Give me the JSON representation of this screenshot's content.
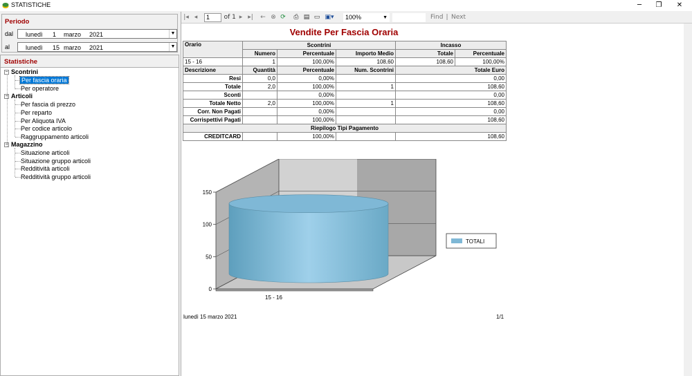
{
  "window": {
    "title": "STATISTICHE",
    "controls": {
      "minimize": "─",
      "maximize": "❐",
      "close": "✕"
    }
  },
  "periodo": {
    "title": "Periodo",
    "from": {
      "label": "dal",
      "weekday": "lunedì",
      "day": "1",
      "month": "marzo",
      "year": "2021"
    },
    "to": {
      "label": "al",
      "weekday": "lunedì",
      "day": "15",
      "month": "marzo",
      "year": "2021"
    }
  },
  "statistiche": {
    "title": "Statistiche",
    "groups": [
      {
        "label": "Scontrini",
        "items": [
          "Per fascia oraria",
          "Per operatore"
        ]
      },
      {
        "label": "Articoli",
        "items": [
          "Per fascia di prezzo",
          "Per reparto",
          "Per Aliquota IVA",
          "Per codice articolo",
          "Raggruppamento articoli"
        ]
      },
      {
        "label": "Magazzino",
        "items": [
          "Situazione articoli",
          "Situazione gruppo articoli",
          "Redditività articoli",
          "Redditività gruppo articoli"
        ]
      }
    ],
    "selected": "Per fascia oraria"
  },
  "toolbar": {
    "page": "1",
    "of_label": "of",
    "total_pages": "1",
    "zoom": "100%",
    "find": "Find",
    "separator": "|",
    "next": "Next"
  },
  "report": {
    "title": "Vendite Per Fascia Oraria",
    "header1": {
      "orario": "Orario",
      "scontrini": "Scontrini",
      "incasso": "Incasso"
    },
    "header2": {
      "numero": "Numero",
      "percentuale": "Percentuale",
      "importo_medio": "Importo Medio",
      "totale": "Totale",
      "percentuale2": "Percentuale"
    },
    "row": {
      "orario": "15 - 16",
      "numero": "1",
      "percentuale": "100,00%",
      "importo_medio": "108,60",
      "totale": "108,60",
      "percentuale2": "100,00%"
    },
    "detail_header": {
      "descrizione": "Descrizione",
      "quantita": "Quantità",
      "percentuale": "Percentuale",
      "num_scontrini": "Num. Scontrini",
      "totale_euro": "Totale Euro"
    },
    "details": [
      {
        "desc": "Resi",
        "qta": "0,0",
        "perc": "0,00%",
        "num": "",
        "tot": "0,00"
      },
      {
        "desc": "Totale",
        "qta": "2,0",
        "perc": "100,00%",
        "num": "1",
        "tot": "108,60"
      },
      {
        "desc": "Sconti",
        "qta": "",
        "perc": "0,00%",
        "num": "",
        "tot": "0,00"
      },
      {
        "desc": "Totale Netto",
        "qta": "2,0",
        "perc": "100,00%",
        "num": "1",
        "tot": "108,60"
      },
      {
        "desc": "Corr. Non Pagati",
        "qta": "",
        "perc": "0,00%",
        "num": "",
        "tot": "0,00"
      },
      {
        "desc": "Corrispettivi Pagati",
        "qta": "",
        "perc": "100,00%",
        "num": "",
        "tot": "108,60"
      }
    ],
    "riepilogo_title": "Riepilogo Tipi Pagamento",
    "pagamenti": [
      {
        "desc": "CREDITCARD",
        "perc": "100,00%",
        "tot": "108,60"
      }
    ],
    "footer_date": "lunedì 15 marzo 2021",
    "footer_page": "1/1"
  },
  "chart_data": {
    "type": "bar",
    "categories": [
      "15 - 16"
    ],
    "series": [
      {
        "name": "TOTALI",
        "values": [
          108.6
        ]
      }
    ],
    "ylim": [
      0,
      150
    ],
    "yticks": [
      "0",
      "50",
      "100",
      "150"
    ],
    "legend": "right",
    "color": "#7fb8d6"
  }
}
